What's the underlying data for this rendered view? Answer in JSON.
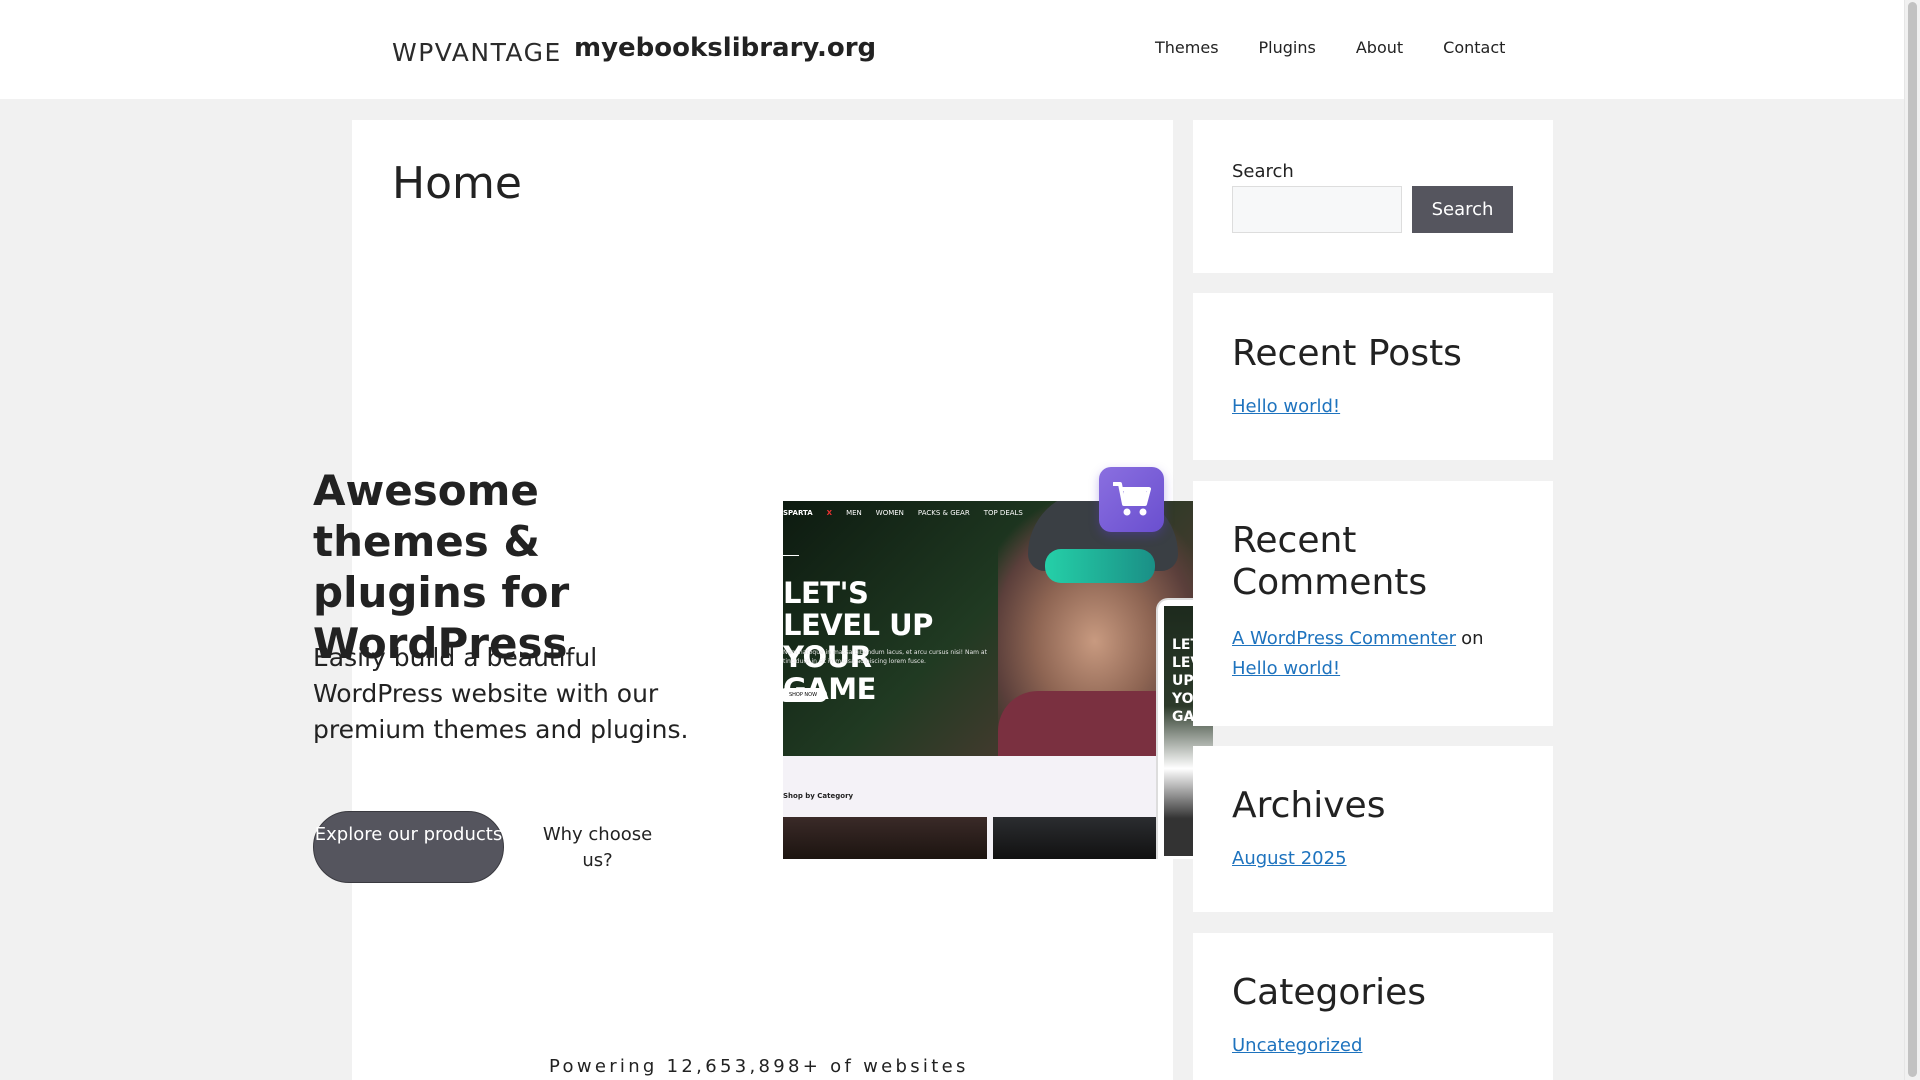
{
  "header": {
    "logo_text": "WPVANTAGE",
    "site_title": "myebookslibrary.org",
    "nav": [
      "Themes",
      "Plugins",
      "About",
      "Contact"
    ]
  },
  "main": {
    "page_title": "Home",
    "hero_title": "Awesome themes & plugins for WordPress",
    "hero_subtitle": "Easily build a beautiful WordPress website with our premium themes and plugins.",
    "explore_button": "Explore our products",
    "why_button": "Why choose us?",
    "powering_text": "Powering 12,653,898+ of websites"
  },
  "mockup": {
    "brand_prefix": "SPARTA",
    "brand_suffix": "X",
    "nav": [
      "MEN",
      "WOMEN",
      "PACKS & GEAR",
      "TOP DEALS"
    ],
    "headline": "LET'S LEVEL UP YOUR GAME",
    "body": "Nam natoque in massa bibendum lacus, et arcu cursus nisi! Nam at tincidunt in sit in massa adipiscing lorem fusce.",
    "shop_button": "SHOP NOW",
    "category_label": "Shop by Category",
    "phone_headline": "LET'S LEVEL UP YOUR GAME",
    "cart_icon": "shopping-cart-icon"
  },
  "sidebar": {
    "search_label": "Search",
    "search_button": "Search",
    "search_value": "",
    "recent_posts_title": "Recent Posts",
    "recent_posts": [
      "Hello world!"
    ],
    "recent_comments_title": "Recent Comments",
    "comment_author": "A WordPress Commenter",
    "comment_on": "on",
    "comment_post": "Hello world!",
    "archives_title": "Archives",
    "archives": [
      "August 2025"
    ],
    "categories_title": "Categories",
    "categories": [
      "Uncategorized"
    ]
  },
  "colors": {
    "link": "#1e73be",
    "button": "#55555e",
    "background": "#f1f1f1",
    "cart_badge": "#7a5fd8"
  }
}
